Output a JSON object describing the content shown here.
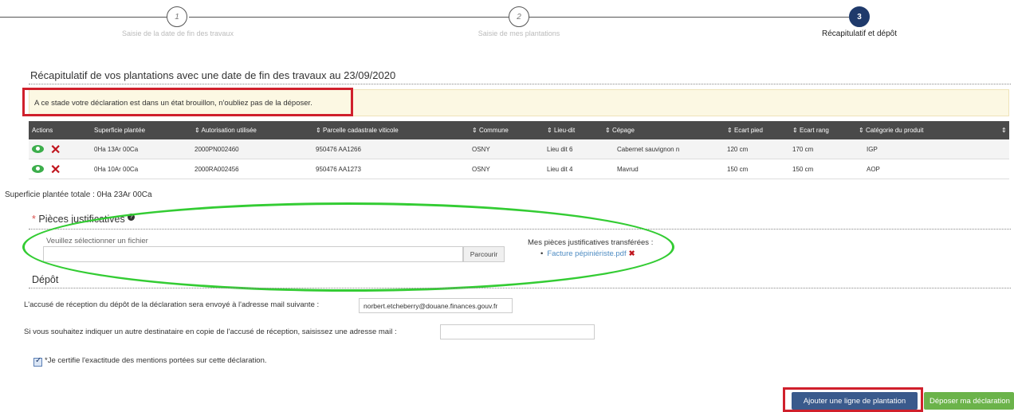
{
  "stepper": {
    "steps": [
      {
        "number": "1",
        "label": "Saisie de la date de fin des travaux"
      },
      {
        "number": "2",
        "label": "Saisie de mes plantations"
      },
      {
        "number": "3",
        "label": "Récapitulatif et dépôt"
      }
    ],
    "active_step": 3
  },
  "summary": {
    "title": "Récapitulatif de vos plantations avec une date de fin des travaux au 23/09/2020",
    "alert": "A ce stade votre déclaration est dans un état brouillon, n'oubliez pas de la déposer."
  },
  "table": {
    "headers": [
      "Actions",
      "Superficie plantée",
      "Autorisation utilisée",
      "Parcelle cadastrale viticole",
      "Commune",
      "Lieu-dit",
      "Cépage",
      "Ecart pied",
      "Ecart rang",
      "Catégorie du produit"
    ],
    "rows": [
      {
        "superficie": "0Ha 13Ar 00Ca",
        "autorisation": "2000PN002460",
        "parcelle": "950476  AA1266",
        "commune": "OSNY",
        "lieu_dit": "Lieu dit 6",
        "cepage": "Cabernet sauvignon n",
        "ecart_pied": "120 cm",
        "ecart_rang": "170 cm",
        "categorie": "IGP"
      },
      {
        "superficie": "0Ha 10Ar 00Ca",
        "autorisation": "2000RA002456",
        "parcelle": "950476  AA1273",
        "commune": "OSNY",
        "lieu_dit": "Lieu dit 4",
        "cepage": "Mavrud",
        "ecart_pied": "150 cm",
        "ecart_rang": "150 cm",
        "categorie": "AOP"
      }
    ],
    "total": "Superficie plantée totale : 0Ha 23Ar 00Ca"
  },
  "pieces": {
    "required_marker": "*",
    "title": "Pièces justificatives",
    "help_icon": "?",
    "file_label": "Veuillez sélectionner un fichier",
    "browse_label": "Parcourir",
    "transferred_label": "Mes pièces justificatives transférées :",
    "files": [
      "Facture pépiniériste.pdf"
    ],
    "delete_symbol": "✖"
  },
  "depot": {
    "title": "Dépôt",
    "email_text": "L'accusé de réception du dépôt de la déclaration sera envoyé à l'adresse mail suivante :",
    "email_value": "norbert.etcheberry@douane.finances.gouv.fr",
    "copy_text": "Si vous souhaitez indiquer un autre destinataire en copie de l'accusé de réception, saisissez une adresse mail :",
    "copy_value": "",
    "certify_text": "*Je certifie l'exactitude des mentions portées sur cette déclaration.",
    "certify_checked": true
  },
  "buttons": {
    "add_line": "Ajouter une ligne de plantation",
    "submit": "Déposer ma déclaration"
  },
  "colors": {
    "primary": "#3a5a8c",
    "success": "#6bb34a",
    "highlight_red": "#d0202c",
    "highlight_green": "#33cc33",
    "alert_bg": "#fcf8e3"
  }
}
